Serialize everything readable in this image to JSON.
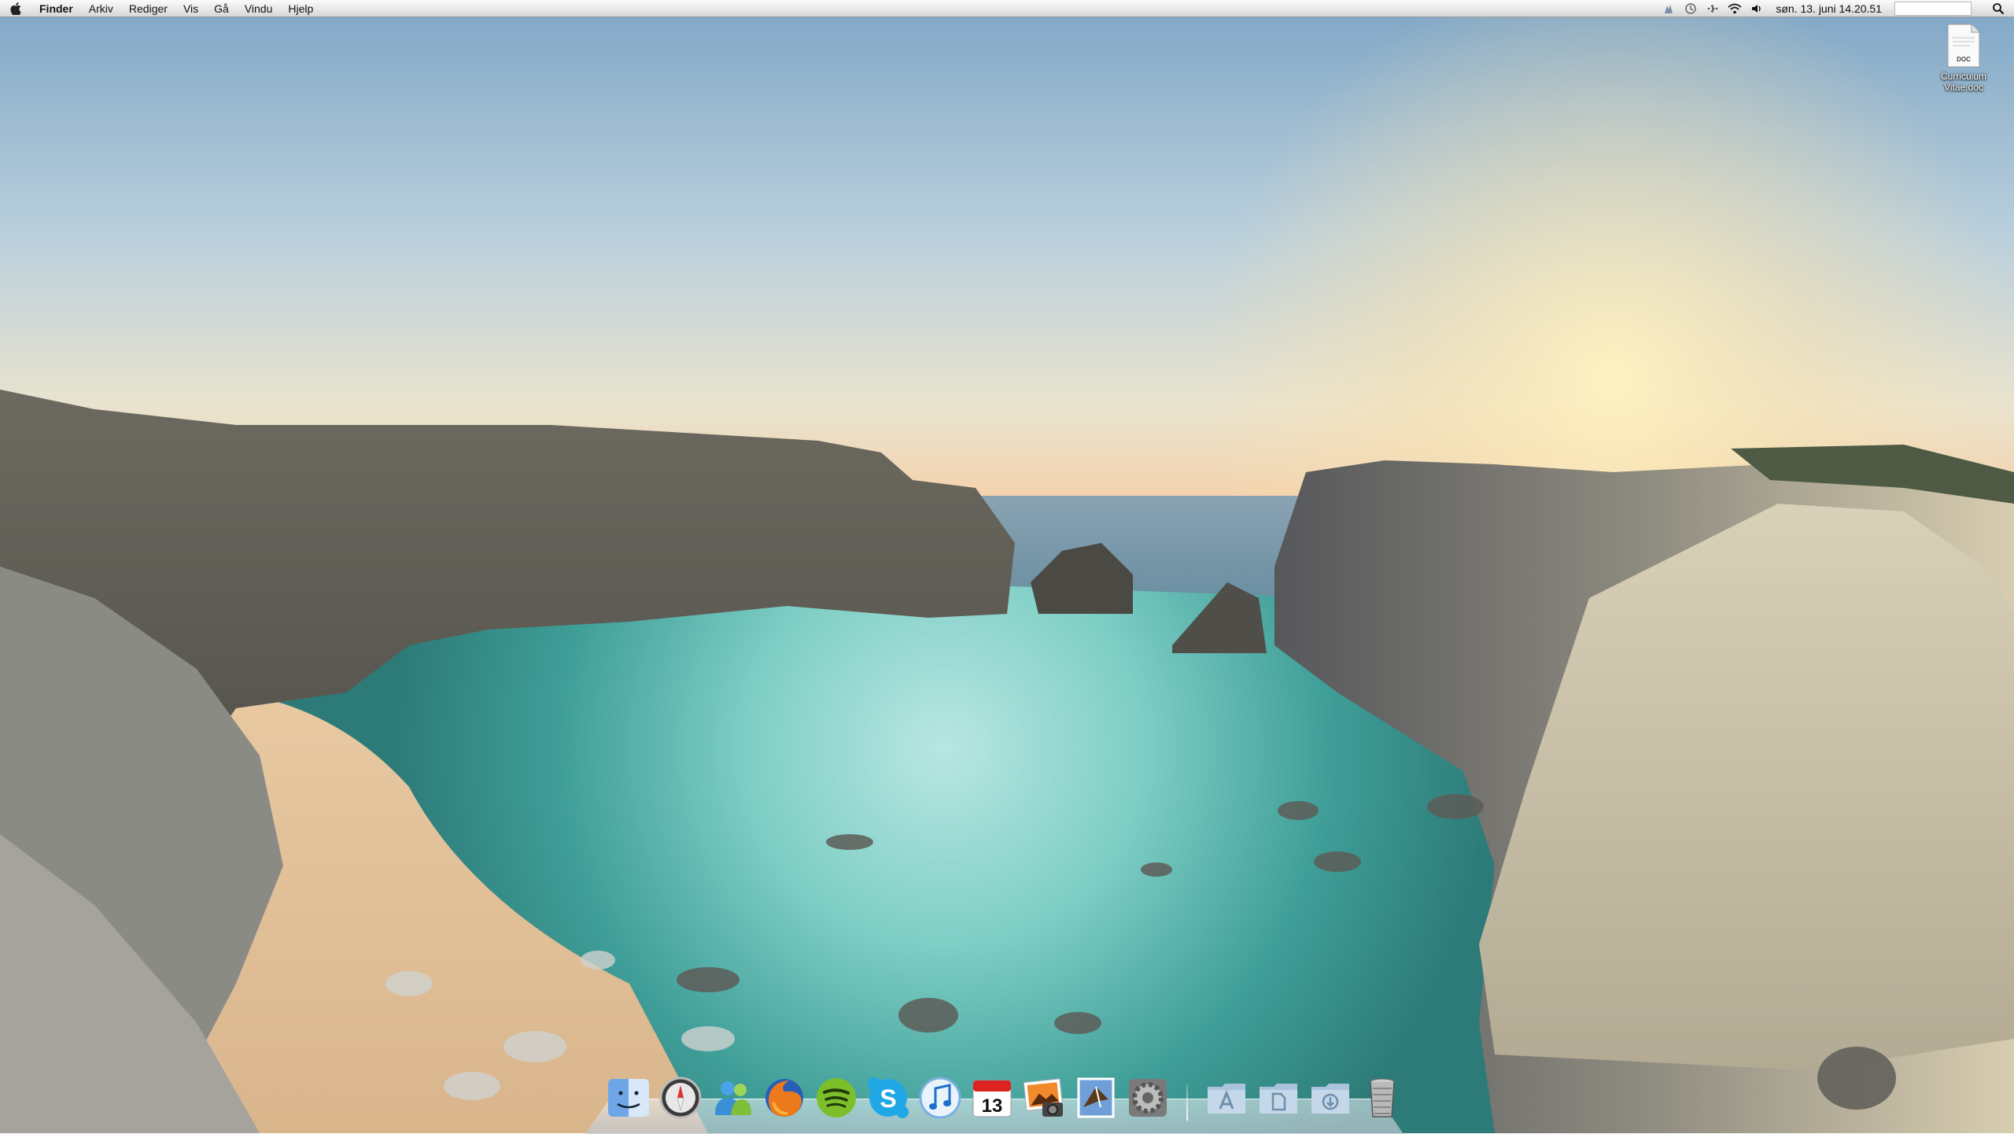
{
  "menubar": {
    "app_name": "Finder",
    "menus": [
      "Arkiv",
      "Rediger",
      "Vis",
      "Gå",
      "Vindu",
      "Hjelp"
    ],
    "status_icons": [
      "growl-icon",
      "time-machine-icon",
      "bluetooth-icon",
      "wifi-icon",
      "volume-icon"
    ],
    "clock": "søn. 13. juni  14.20.51"
  },
  "desktop": {
    "file": {
      "type_label": "DOC",
      "name": "Curriculum Vitae.doc"
    }
  },
  "dock": {
    "apps": [
      "finder-icon",
      "safari-icon",
      "messenger-icon",
      "firefox-icon",
      "spotify-icon",
      "skype-icon",
      "itunes-icon",
      "ical-icon",
      "iphoto-icon",
      "mail-icon",
      "system-preferences-icon"
    ],
    "calendar_day": "13",
    "stacks": [
      "applications-folder-icon",
      "documents-folder-icon",
      "downloads-folder-icon",
      "trash-icon"
    ]
  },
  "colors": {
    "sky_top": "#7fa6c6",
    "sunset": "#f7d9a8",
    "water": "#59b8ad",
    "rock": "#5a5a55"
  }
}
